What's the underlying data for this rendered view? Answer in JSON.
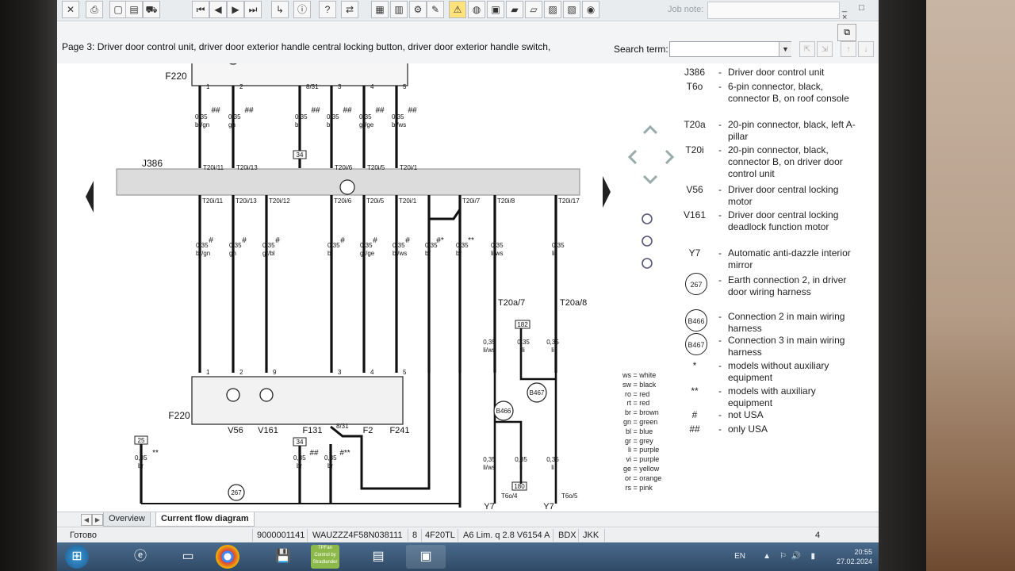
{
  "toolbar": {
    "buttons": [
      "close",
      "print",
      "page",
      "page-list",
      "car",
      "first",
      "prev",
      "next",
      "last",
      "jump",
      "info",
      "help",
      "swap",
      "doc1",
      "doc2",
      "doc3",
      "doc4",
      "warning",
      "globe",
      "doc5",
      "doc6",
      "doc7",
      "doc8",
      "doc9",
      "doc10"
    ],
    "job_note_label": "Job note:",
    "window_controls": "_ □ ×"
  },
  "page": {
    "title": "Page 3: Driver door control unit, driver door exterior handle central locking button, driver door exterior handle switch,",
    "search_label": "Search term:",
    "search_value": ""
  },
  "diagram": {
    "components": {
      "f220_top": "F220",
      "j386": "J386",
      "f220_bottom": "F220",
      "v56": "V56",
      "v161": "V161",
      "f131": "F131",
      "f2": "F2",
      "f241": "F241",
      "y7_left": "Y7",
      "y7_right": "Y7"
    },
    "top_wires": [
      {
        "pin": "1",
        "size": "0,35",
        "color": "br/gn",
        "mark": "##",
        "conn": "T20i/11"
      },
      {
        "pin": "2",
        "size": "0,35",
        "color": "gn",
        "mark": "##",
        "conn": "T20i/13"
      },
      {
        "pin": "8/31",
        "size": "0,35",
        "color": "br",
        "mark": "##",
        "conn": ""
      },
      {
        "pin": "3",
        "size": "0,35",
        "color": "bl",
        "mark": "##",
        "conn": "T20i/6"
      },
      {
        "pin": "4",
        "size": "0,35",
        "color": "gr/ge",
        "mark": "##",
        "conn": "T20i/5"
      },
      {
        "pin": "5",
        "size": "0,35",
        "color": "bl/ws",
        "mark": "##",
        "conn": "T20i/1"
      }
    ],
    "mid_wires": [
      {
        "conn": "T20i/11",
        "size": "0,35",
        "color": "br/gn",
        "mark": "#"
      },
      {
        "conn": "T20i/13",
        "size": "0,35",
        "color": "gn",
        "mark": "#"
      },
      {
        "conn": "T20i/12",
        "size": "0,35",
        "color": "gr/bl",
        "mark": "#"
      },
      {
        "conn": "T20i/6",
        "size": "0,35",
        "color": "bl",
        "mark": "#"
      },
      {
        "conn": "T20i/5",
        "size": "0,35",
        "color": "gr/ge",
        "mark": "#"
      },
      {
        "conn": "T20i/1",
        "size": "0,35",
        "color": "bl/ws",
        "mark": "#"
      },
      {
        "conn": "",
        "size": "0,35",
        "color": "br",
        "mark": "#*"
      },
      {
        "conn": "T20i/7",
        "size": "0,35",
        "color": "br",
        "mark": "**"
      },
      {
        "conn": "T20i/8",
        "size": "0,35",
        "color": "li/ws",
        "mark": ""
      },
      {
        "conn": "T20i/17",
        "size": "0,35",
        "color": "li",
        "mark": ""
      }
    ],
    "bottom_pins": [
      "1",
      "2",
      "9",
      "3",
      "4",
      "5"
    ],
    "ref_boxes": [
      "34",
      "25",
      "34",
      "182",
      "180"
    ],
    "connectors": [
      "T20a/7",
      "T20a/8",
      "T6o/4",
      "T6o/5"
    ],
    "lower_wires": [
      {
        "size": "0,35",
        "color": "li/ws"
      },
      {
        "size": "0,35",
        "color": "li"
      },
      {
        "size": "0,35",
        "color": "li"
      },
      {
        "size": "0,35",
        "color": "li/ws"
      },
      {
        "size": "0,35",
        "color": "li"
      },
      {
        "size": "0,35",
        "color": "li"
      }
    ],
    "bottom_left_wires": [
      {
        "size": "0,35",
        "color": "br",
        "mark": "**"
      },
      {
        "size": "0,35",
        "color": "br",
        "mark": "##"
      },
      {
        "size": "0,35",
        "color": "br",
        "mark": "#**"
      }
    ],
    "pin_831": "8/31",
    "earth_points": [
      "267",
      "B466",
      "B467"
    ]
  },
  "legend": [
    {
      "code": "J386",
      "desc": "Driver door control unit"
    },
    {
      "code": "T6o",
      "desc": "6-pin connector, black, connector B, on roof console"
    },
    {
      "code": "T20a",
      "desc": "20-pin connector, black, left A-pillar"
    },
    {
      "code": "T20i",
      "desc": "20-pin connector, black, connector B, on driver door control unit"
    },
    {
      "code": "V56",
      "desc": "Driver door central locking motor"
    },
    {
      "code": "V161",
      "desc": "Driver door central locking deadlock function motor"
    },
    {
      "code": "Y7",
      "desc": "Automatic anti-dazzle interior mirror"
    },
    {
      "code": "267",
      "desc": "Earth connection 2, in driver door wiring harness"
    },
    {
      "code": "B466",
      "desc": "Connection 2 in main wiring harness"
    },
    {
      "code": "B467",
      "desc": "Connection 3 in main wiring harness"
    },
    {
      "code": "*",
      "desc": "models without auxiliary equipment"
    },
    {
      "code": "**",
      "desc": "models with auxiliary equipment"
    },
    {
      "code": "#",
      "desc": "not USA"
    },
    {
      "code": "##",
      "desc": "only USA"
    }
  ],
  "color_key": [
    {
      "c": "ws",
      "n": "white"
    },
    {
      "c": "sw",
      "n": "black"
    },
    {
      "c": "ro",
      "n": "red"
    },
    {
      "c": "rt",
      "n": "red"
    },
    {
      "c": "br",
      "n": "brown"
    },
    {
      "c": "gn",
      "n": "green"
    },
    {
      "c": "bl",
      "n": "blue"
    },
    {
      "c": "gr",
      "n": "grey"
    },
    {
      "c": "li",
      "n": "purple"
    },
    {
      "c": "vi",
      "n": "purple"
    },
    {
      "c": "ge",
      "n": "yellow"
    },
    {
      "c": "or",
      "n": "orange"
    },
    {
      "c": "rs",
      "n": "pink"
    }
  ],
  "tabs": {
    "overview": "Overview",
    "current": "Current flow diagram"
  },
  "status": {
    "left": "Готово",
    "doc_no": "9000001141",
    "vin": "WAUZZZ4F58N038111",
    "num": "8",
    "code": "4F20TL",
    "model": "A6 Lim. q 2.8 V6154 A",
    "engine": "BDX",
    "gearbox": "JKK",
    "page": "4"
  },
  "taskbar": {
    "lang": "EN",
    "time": "20:55",
    "date": "27.02.2024",
    "tray_app_label": "TPFan Control by Stradlander"
  }
}
